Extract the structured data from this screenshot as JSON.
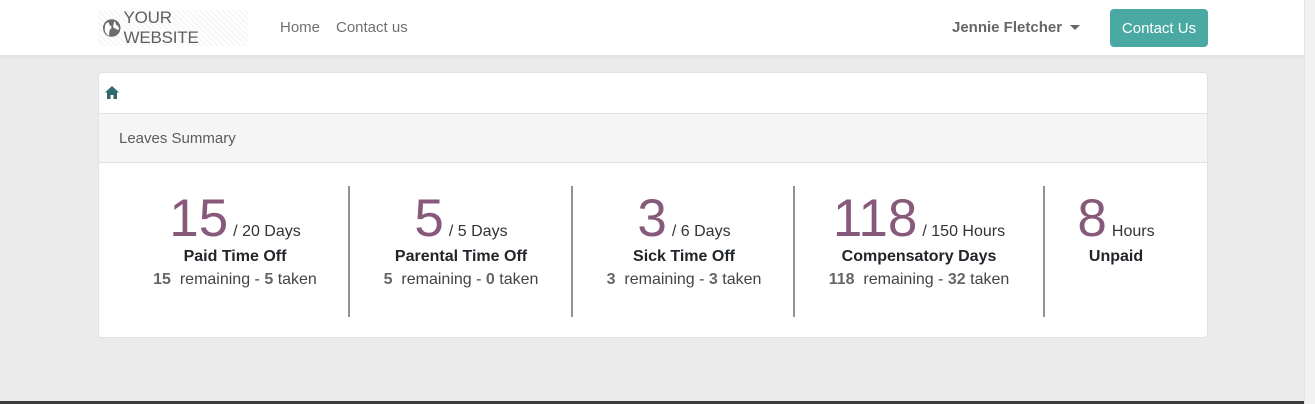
{
  "navbar": {
    "brand": "YOUR WEBSITE",
    "links": [
      "Home",
      "Contact us"
    ],
    "user": "Jennie Fletcher",
    "cta": "Contact Us"
  },
  "card": {
    "header": "Leaves Summary",
    "items": [
      {
        "value": "15",
        "unit": "/ 20 Days",
        "name": "Paid Time Off",
        "remaining": "15",
        "remaining_label": "remaining -",
        "taken": "5",
        "taken_label": "taken"
      },
      {
        "value": "5",
        "unit": "/ 5 Days",
        "name": "Parental Time Off",
        "remaining": "5",
        "remaining_label": "remaining -",
        "taken": "0",
        "taken_label": "taken"
      },
      {
        "value": "3",
        "unit": "/ 6 Days",
        "name": "Sick Time Off",
        "remaining": "3",
        "remaining_label": "remaining -",
        "taken": "3",
        "taken_label": "taken"
      },
      {
        "value": "118",
        "unit": "/ 150 Hours",
        "name": "Compensatory Days",
        "remaining": "118",
        "remaining_label": "remaining -",
        "taken": "32",
        "taken_label": "taken"
      },
      {
        "value": "8",
        "unit": "Hours",
        "name": "Unpaid"
      }
    ]
  },
  "colors": {
    "accent": "#875a7b",
    "cta": "#4aa9a2",
    "home_icon": "#2e6b6a"
  },
  "icons": [
    "globe-icon",
    "home-icon",
    "caret-down-icon"
  ]
}
